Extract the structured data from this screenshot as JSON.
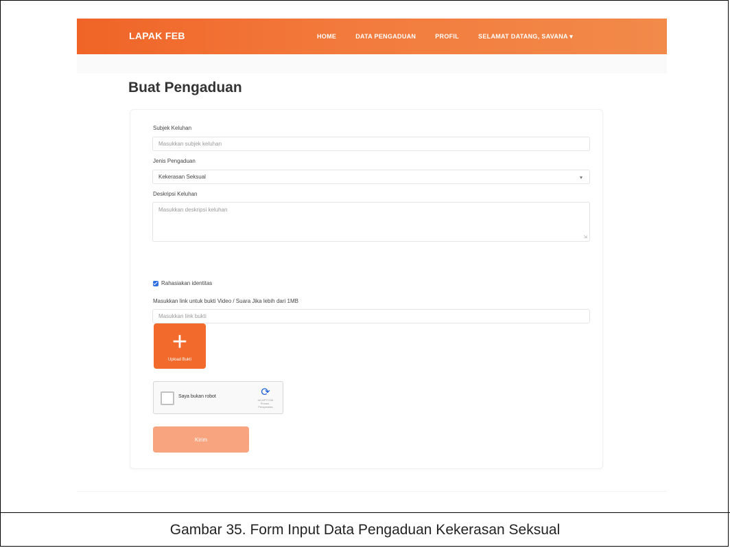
{
  "navbar": {
    "brand": "LAPAK FEB",
    "items": [
      "HOME",
      "DATA PENGADUAN",
      "PROFIL",
      "SELAMAT DATANG, SAVANA"
    ]
  },
  "page": {
    "title": "Buat Pengaduan"
  },
  "form": {
    "subject_label": "Subjek Keluhan",
    "subject_placeholder": "Masukkan subjek keluhan",
    "type_label": "Jenis Pengaduan",
    "type_selected": "Kekerasan Seksual",
    "description_label": "Deskripsi Keluhan",
    "description_placeholder": "Masukkan deskripsi keluhan",
    "anonymous_label": "Rahasiakan identitas",
    "anonymous_checked": true,
    "link_label": "Masukkan link untuk bukti Video / Suara Jika lebih dari 1MB",
    "link_placeholder": "Masukkan link bukti",
    "upload_label": "Upload Bukti",
    "recaptcha_label": "Saya bukan robot",
    "recaptcha_brand": "reCAPTCHA",
    "recaptcha_terms": "Privasi - Persyaratan",
    "submit_label": "Kirim"
  },
  "caption": "Gambar 35. Form Input Data Pengaduan Kekerasan Seksual",
  "colors": {
    "accent": "#f26a2c",
    "submit_disabled": "#f8a47f",
    "checkbox": "#2f6fe4"
  }
}
